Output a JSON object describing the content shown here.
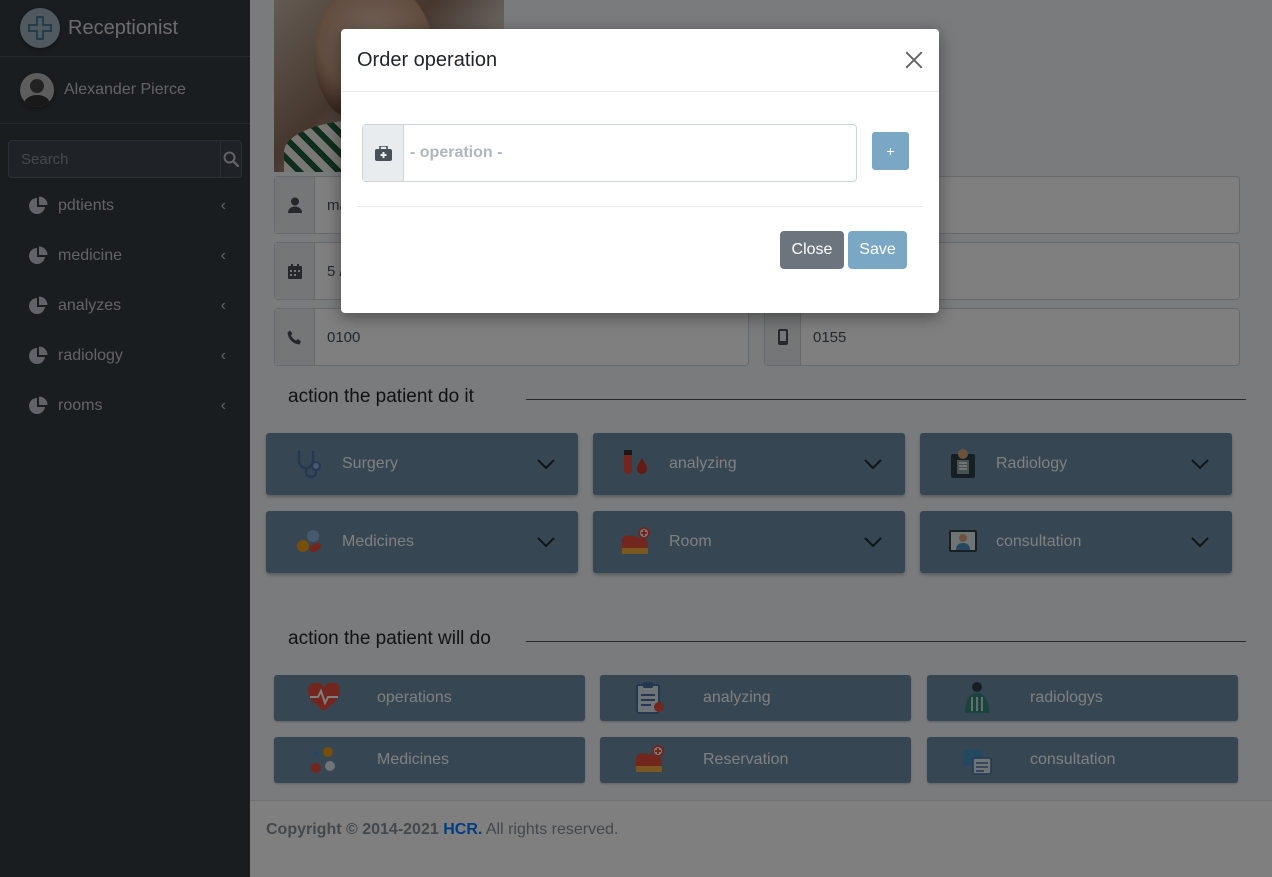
{
  "brand": {
    "title": "Receptionist",
    "logo_icon": "medical-cross-logo"
  },
  "user": {
    "name": "Alexander Pierce"
  },
  "search": {
    "placeholder": "Search"
  },
  "sidebar": {
    "items": [
      {
        "label": "pdtients",
        "icon": "pie-chart-icon"
      },
      {
        "label": "medicine",
        "icon": "pie-chart-icon"
      },
      {
        "label": "analyzes",
        "icon": "pie-chart-icon"
      },
      {
        "label": "radiology",
        "icon": "pie-chart-icon"
      },
      {
        "label": "rooms",
        "icon": "pie-chart-icon"
      }
    ]
  },
  "profile": {
    "name_partial": "ma",
    "date_partial": "5 /",
    "phone": "0100",
    "mobile": "0155"
  },
  "sections": {
    "did": "action the patient do it",
    "will": "action the patient will do"
  },
  "did_cards": [
    {
      "label": "Surgery",
      "icon": "stethoscope-icon"
    },
    {
      "label": "analyzing",
      "icon": "test-tube-icon"
    },
    {
      "label": "Radiology",
      "icon": "xray-icon"
    },
    {
      "label": "Medicines",
      "icon": "pills-icon"
    },
    {
      "label": "Room",
      "icon": "bed-icon"
    },
    {
      "label": "consultation",
      "icon": "doctor-icon"
    }
  ],
  "will_cards": [
    {
      "label": "operations",
      "icon": "heartbeat-icon"
    },
    {
      "label": "analyzing",
      "icon": "clipboard-icon"
    },
    {
      "label": "radiologys",
      "icon": "xray-icon"
    },
    {
      "label": "Medicines",
      "icon": "pills-icon"
    },
    {
      "label": "Reservation",
      "icon": "bed-icon"
    },
    {
      "label": "consultation",
      "icon": "doctor-icon"
    }
  ],
  "footer": {
    "copyright": "Copyright © 2014-2021",
    "brand": "HCR.",
    "rights": "All rights reserved."
  },
  "modal": {
    "title": "Order operation",
    "operation_placeholder": "- operation -",
    "plus_label": "+",
    "close_label": "Close",
    "save_label": "Save"
  },
  "colors": {
    "sidebar": "#343a40",
    "card": "#6c8ea7",
    "accent": "#7aa8c4",
    "close_button": "#6c757d",
    "link": "#007bff"
  }
}
